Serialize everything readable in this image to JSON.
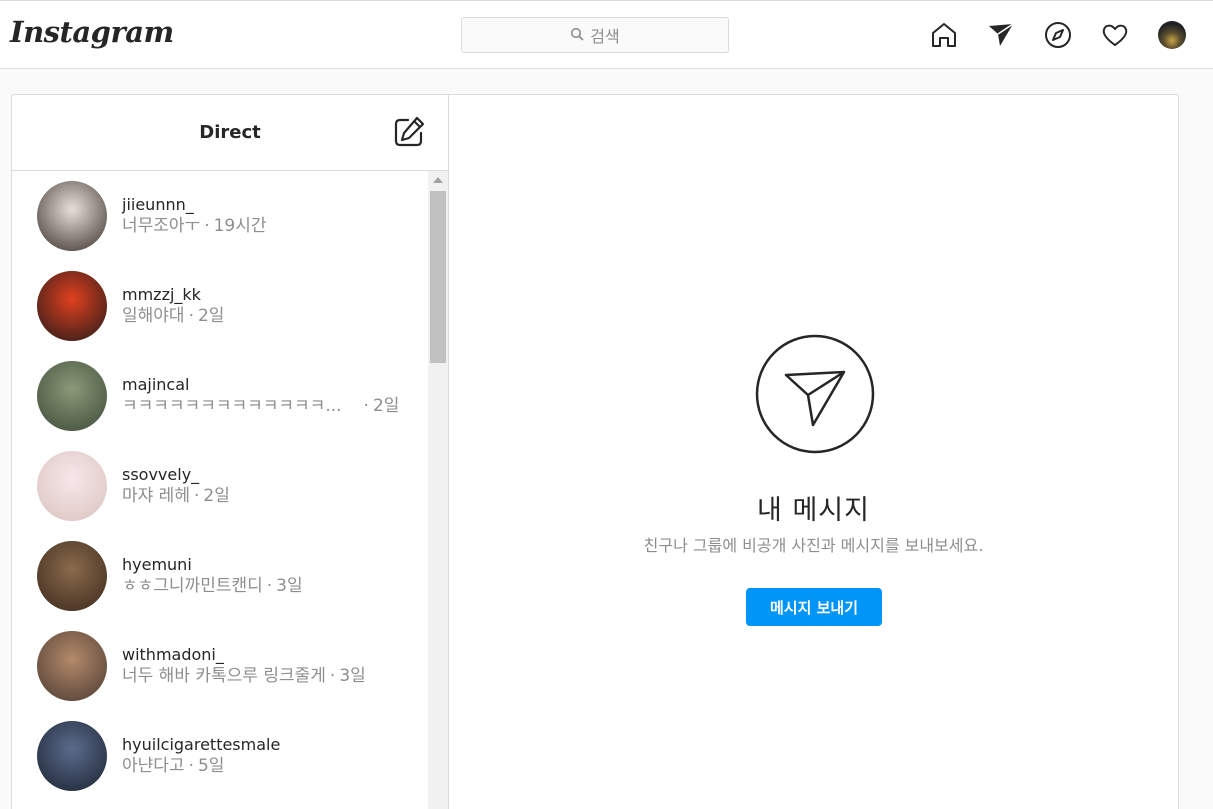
{
  "header": {
    "logo": "Instagram",
    "search_placeholder": "검색",
    "icons": [
      "home-icon",
      "direct-icon",
      "explore-icon",
      "heart-icon",
      "profile-avatar"
    ]
  },
  "inbox": {
    "title": "Direct",
    "threads": [
      {
        "username": "jiieunnn_",
        "preview": "너무조아ㅜ",
        "time": "19시간",
        "avatar_colors": [
          "#e8e1d9",
          "#3a2e2a"
        ]
      },
      {
        "username": "mmzzj_kk",
        "preview": "일해야대",
        "time": "2일",
        "avatar_colors": [
          "#e0401f",
          "#231a1a"
        ]
      },
      {
        "username": "majincal",
        "preview": "ㅋㅋㅋㅋㅋㅋㅋㅋㅋㅋㅋㅋㅋ...",
        "time": "2일",
        "avatar_colors": [
          "#8a9a78",
          "#3d4a38"
        ]
      },
      {
        "username": "ssovvely_",
        "preview": "마쟈 레헤",
        "time": "2일",
        "avatar_colors": [
          "#f7e6ea",
          "#d9c3bd"
        ]
      },
      {
        "username": "hyemuni",
        "preview": "ㅎㅎ그니까민트캔디",
        "time": "3일",
        "avatar_colors": [
          "#8a6a4c",
          "#3b2a1c"
        ]
      },
      {
        "username": "withmadoni_",
        "preview": "너두 해바 카톡으루 링크줄게",
        "time": "3일",
        "avatar_colors": [
          "#b58a6a",
          "#4a3a32"
        ]
      },
      {
        "username": "hyuilcigarettesmale",
        "preview": "아냔다고",
        "time": "5일",
        "avatar_colors": [
          "#5a6c8c",
          "#1c2230"
        ]
      }
    ]
  },
  "empty_state": {
    "title": "내 메시지",
    "subtitle": "친구나 그룹에 비공개 사진과 메시지를 보내보세요.",
    "button_label": "메시지 보내기"
  },
  "colors": {
    "accent": "#0095f6",
    "border": "#dbdbdb",
    "muted_text": "#8e8e8e"
  }
}
